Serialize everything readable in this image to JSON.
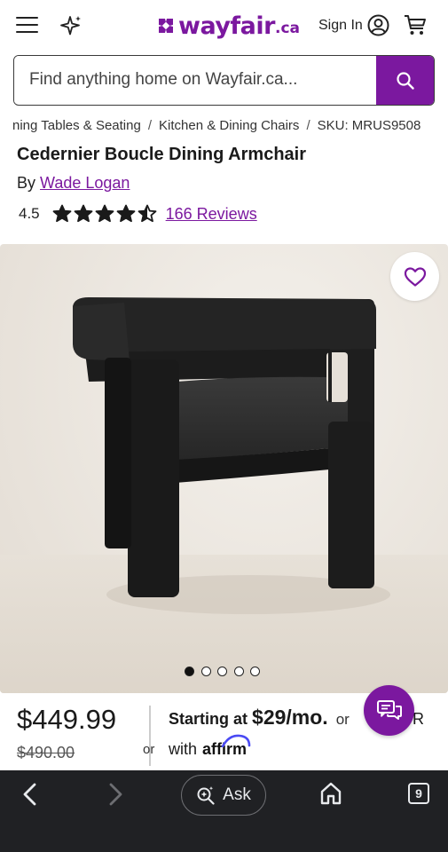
{
  "header": {
    "logo_text": "wayfair",
    "logo_suffix": ".ca",
    "sign_in_label": "Sign In",
    "brand_color": "#7b189f",
    "icons": [
      "menu-icon",
      "sparkle-icon",
      "user-icon",
      "cart-icon"
    ]
  },
  "search": {
    "placeholder": "Find anything home on Wayfair.ca...",
    "button_icon": "search-icon"
  },
  "breadcrumb": {
    "items": [
      "ning Tables & Seating",
      "Kitchen & Dining Chairs",
      "SKU: MRUS9508"
    ],
    "separator": "/"
  },
  "product": {
    "title": "Cedernier Boucle Dining Armchair",
    "by_label": "By",
    "brand": "Wade Logan",
    "rating": "4.5",
    "rating_stars": 4.5,
    "rating_max": 5,
    "reviews_label": "166 Reviews"
  },
  "gallery": {
    "image_count": 5,
    "active_index": 0,
    "favorite_icon": "heart-icon"
  },
  "pricing": {
    "price": "$449.99",
    "original_price": "$490.00",
    "or_label": "or",
    "starting_at_label": "Starting at",
    "monthly_amount": "$29/mo.",
    "or_right_label": "or",
    "trailing_text": "R",
    "with_label": "with",
    "affirm_label": "affirm"
  },
  "chat": {
    "icon": "chat-icon"
  },
  "browser_bar": {
    "ask_label": "Ask",
    "tab_count": "9",
    "background": "#202124"
  }
}
